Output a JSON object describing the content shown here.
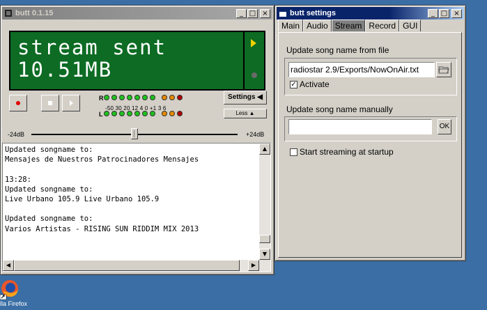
{
  "main_window": {
    "title": "butt 0.1.15",
    "lcd": {
      "line1": "stream sent",
      "line2": "10.51MB"
    },
    "vu": {
      "r_label": "R",
      "l_label": "L",
      "scale": "-50  30  20  12   4   0   +1   3   6",
      "colors": {
        "green": "#1ec21e",
        "orange": "#e88a00",
        "red": "#b00000"
      }
    },
    "settings_button": "Settings",
    "less_button": "Less",
    "slider": {
      "min_label": "-24dB",
      "max_label": "+24dB",
      "value_fraction": 0.5
    },
    "log_lines": [
      "Updated songname to:",
      "Mensajes de Nuestros Patrocinadores Mensajes",
      "",
      "13:28:",
      "Updated songname to:",
      "Live Urbano 105.9 Live Urbano 105.9",
      "",
      "Updated songname to:",
      "Varios Artistas - RISING SUN RIDDIM MIX 2013"
    ]
  },
  "settings_window": {
    "title": "butt settings",
    "tabs": [
      "Main",
      "Audio",
      "Stream",
      "Record",
      "GUI"
    ],
    "active_tab": "Stream",
    "file_group": {
      "title": "Update song name from file",
      "path": "radiostar 2.9/Exports/NowOnAir.txt",
      "activate_label": "Activate",
      "activate_checked": true
    },
    "manual_group": {
      "title": "Update song name manually",
      "value": "",
      "ok_label": "OK"
    },
    "startup_label": "Start streaming at startup",
    "startup_checked": false
  },
  "desktop": {
    "firefox_label": "lla Firefox"
  }
}
